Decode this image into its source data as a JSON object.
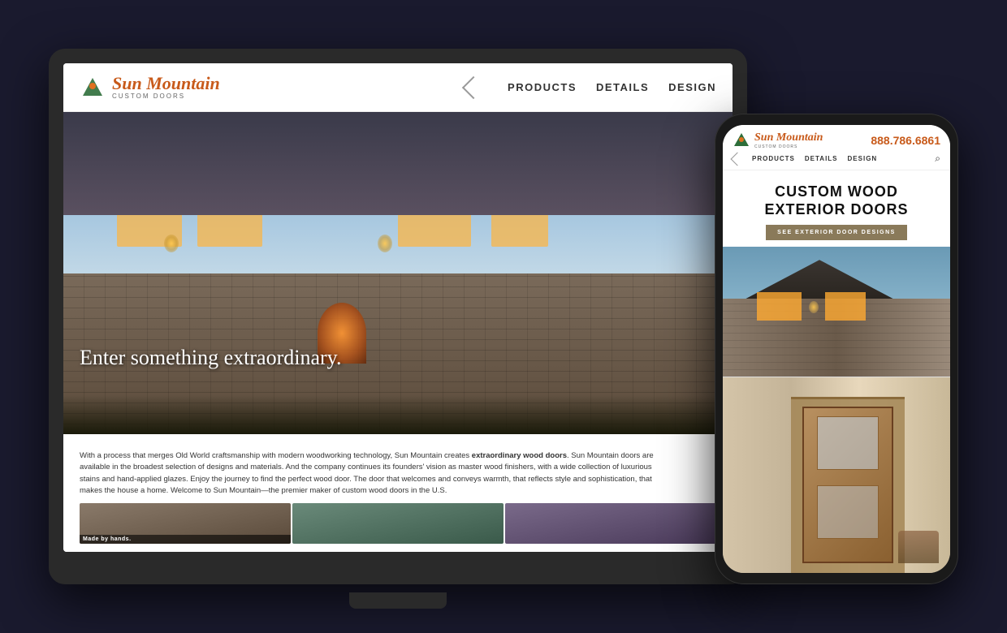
{
  "scene": {
    "background_color": "#1a1a2e"
  },
  "desktop": {
    "header": {
      "brand_name": "Sun Mountain",
      "brand_subtitle": "CUSTOM DOORS",
      "nav_items": [
        "PRODUCTS",
        "DETAILS",
        "DESIGN"
      ]
    },
    "hero": {
      "tagline": "Enter something extraordinary."
    },
    "body": {
      "paragraph": "With a process that merges Old World craftsmanship with modern woodworking technology, Sun Mountain creates extraordinary wood doors. Sun Mountain doors are available in the broadest selection of designs and materials. And the company continues its founders' vision as master wood finishers, with a wide collection of luxurious stains and hand-applied glazes. Enjoy the journey to find the perfect wood door. The door that welcomes and conveys warmth, that reflects style and sophistication, that makes the house a home. Welcome to Sun Mountain—the premier maker of custom wood doors in the U.S."
    },
    "thumbnails": [
      {
        "label": "Made by hands."
      },
      {
        "label": ""
      },
      {
        "label": ""
      }
    ]
  },
  "mobile": {
    "header": {
      "brand_name": "Sun Mountain",
      "brand_subtitle": "CUSTOM DOORS",
      "phone": "888.786.6861",
      "nav_items": [
        "PRODUCTS",
        "DETAILS",
        "DESIGN"
      ]
    },
    "content": {
      "main_title": "CUSTOM WOOD EXTERIOR DOORS",
      "cta_button": "SEE EXTERIOR DOOR DESIGNS"
    }
  }
}
